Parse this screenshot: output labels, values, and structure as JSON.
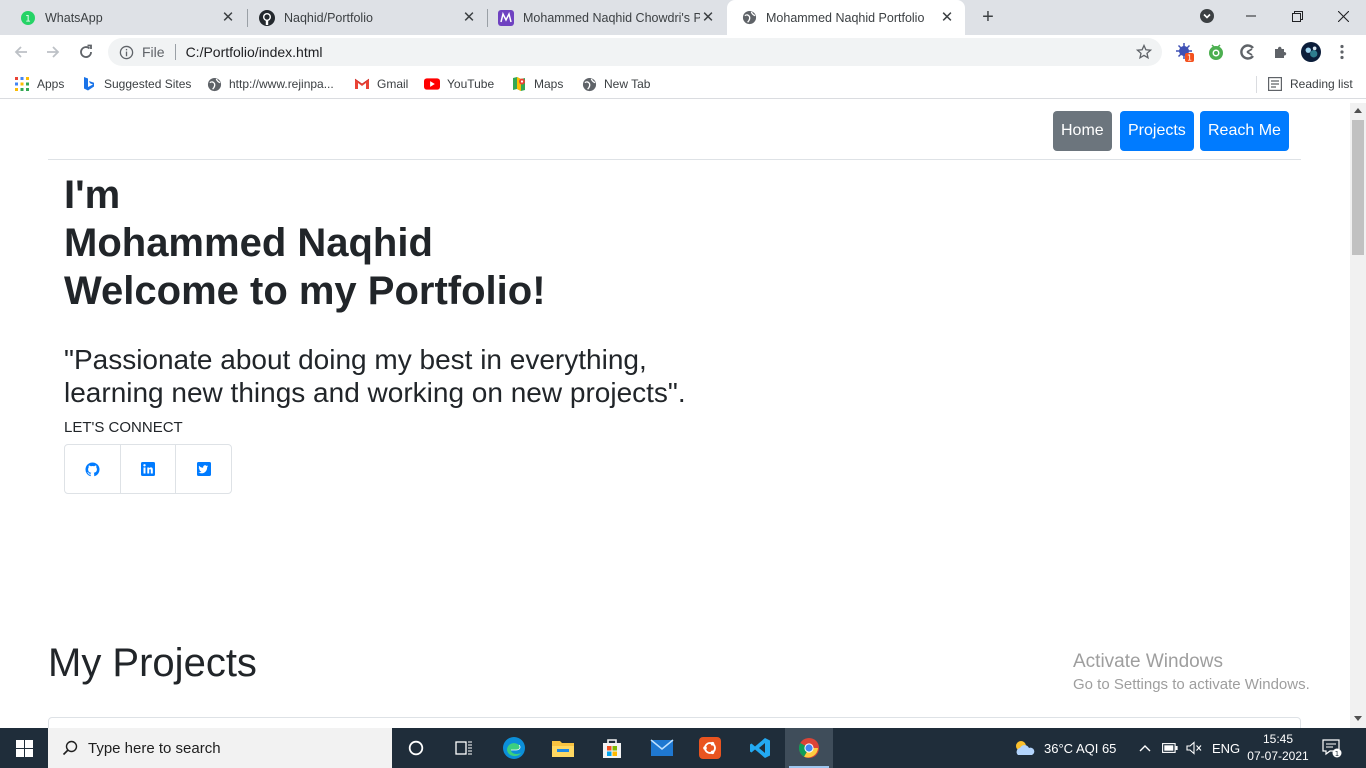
{
  "browser": {
    "tabs": [
      {
        "title": "WhatsApp",
        "icon": "whatsapp-icon",
        "active": false
      },
      {
        "title": "Naqhid/Portfolio",
        "icon": "github-icon",
        "active": false
      },
      {
        "title": "Mohammed Naqhid Chowdri's P",
        "icon": "portfolio-icon",
        "active": false
      },
      {
        "title": "Mohammed Naqhid Portfolio",
        "icon": "globe-icon",
        "active": true
      }
    ],
    "address": {
      "scheme_label": "File",
      "url": "C:/Portfolio/index.html"
    },
    "bookmarks": [
      {
        "label": "Apps",
        "icon": "apps-grid-icon"
      },
      {
        "label": "Suggested Sites",
        "icon": "bing-icon"
      },
      {
        "label": "http://www.rejinpa...",
        "icon": "globe-icon"
      },
      {
        "label": "Gmail",
        "icon": "gmail-icon"
      },
      {
        "label": "YouTube",
        "icon": "youtube-icon"
      },
      {
        "label": "Maps",
        "icon": "maps-icon"
      },
      {
        "label": "New Tab",
        "icon": "globe-icon"
      }
    ],
    "reading_list": "Reading list",
    "extension_badge": "1"
  },
  "page": {
    "nav": {
      "home": "Home",
      "projects": "Projects",
      "reach": "Reach Me"
    },
    "hero": {
      "line1": "I'm",
      "line2": "Mohammed Naqhid",
      "line3": "Welcome to my Portfolio!"
    },
    "quote": {
      "line1": "\"Passionate about doing my best in everything,",
      "line2": "learning new things and working on new projects\"."
    },
    "connect_label": "LET'S CONNECT",
    "social": [
      "github-icon",
      "linkedin-icon",
      "twitter-icon"
    ],
    "projects_title": "My Projects"
  },
  "watermark": {
    "line1": "Activate Windows",
    "line2": "Go to Settings to activate Windows."
  },
  "taskbar": {
    "search_placeholder": "Type here to search",
    "weather": "36°C  AQI 65",
    "language": "ENG",
    "time": "15:45",
    "date": "07-07-2021",
    "notification_count": "1"
  },
  "colors": {
    "primary": "#007bff",
    "secondary": "#6c757d",
    "taskbar": "#1f2d3a"
  }
}
